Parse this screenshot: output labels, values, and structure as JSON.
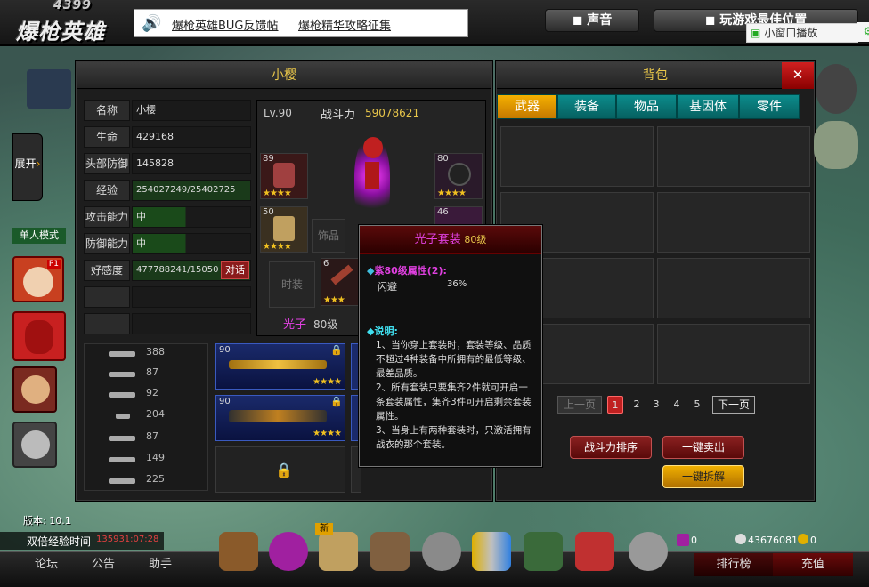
{
  "header": {
    "logo_num": "4399",
    "logo_text": "爆枪英雄",
    "news": [
      "爆枪英雄BUG反馈帖",
      "爆枪精华攻略征集"
    ],
    "sound": "声音",
    "best_pos": "玩游戏最佳位置",
    "small_window": "小窗口播放"
  },
  "sidebar": {
    "expand": "展开",
    "mode": "单人模式",
    "p1": "P1"
  },
  "char": {
    "title": "小樱",
    "level": "Lv.90",
    "power_label": "战斗力",
    "power": "59078621",
    "stats": [
      {
        "label": "名称",
        "value": "小樱"
      },
      {
        "label": "生命",
        "value": "429168"
      },
      {
        "label": "头部防御",
        "value": "145828"
      },
      {
        "label": "经验",
        "value": "254027249/25402725"
      },
      {
        "label": "攻击能力",
        "value": "中"
      },
      {
        "label": "防御能力",
        "value": "中"
      },
      {
        "label": "好感度",
        "value": "477788241/15050"
      }
    ],
    "talk": "对话",
    "slots": {
      "chest_lv": "89",
      "helmet_lv": "80",
      "pants_lv": "50",
      "boots_lv": "46",
      "accessory": "饰品",
      "fashion": "时装",
      "weapon_lv": "6"
    },
    "suit_label": "光子",
    "suit_level": "80级"
  },
  "weapons": {
    "list": [
      {
        "count": "388"
      },
      {
        "count": "87"
      },
      {
        "count": "92"
      },
      {
        "count": "204"
      },
      {
        "count": "87"
      },
      {
        "count": "149"
      },
      {
        "count": "225"
      }
    ],
    "card_levels": [
      "90",
      "90"
    ]
  },
  "bag": {
    "title": "背包",
    "close": "✕",
    "tabs": [
      "武器",
      "装备",
      "物品",
      "基因体",
      "零件"
    ],
    "prev": "上一页",
    "next": "下一页",
    "pages": [
      "1",
      "2",
      "3",
      "4",
      "5"
    ],
    "rank_btn": "战斗力排序",
    "sell_btn": "一键卖出",
    "dismantle_btn": "一键拆解"
  },
  "tooltip": {
    "name": "光子套装",
    "level": "80级",
    "attr_title": "紫80级属性(2):",
    "attr_name": "闪避",
    "attr_value": "36%",
    "desc_title": "说明:",
    "desc": [
      "1、当你穿上套装时，套装等级、品质不超过4种装备中所拥有的最低等级、最差品质。",
      "2、所有套装只要集齐2件就可开启一条套装属性，集齐3件可开启剩余套装属性。",
      "3、当身上有两种套装时，只激活拥有战衣的那个套装。"
    ]
  },
  "footer": {
    "version": "版本: 10.1",
    "double_exp": "双倍经验时间",
    "double_exp_val": "135931:07:28",
    "forum": "论坛",
    "notice": "公告",
    "helper": "助手",
    "new_badge": "新",
    "gems": "0",
    "silver": "436760819",
    "gold": "0",
    "rank": "排行榜",
    "recharge": "充值"
  },
  "colors": {
    "gold": "#e8c64a",
    "teal": "#0c8c8c",
    "red": "#8a2020"
  }
}
